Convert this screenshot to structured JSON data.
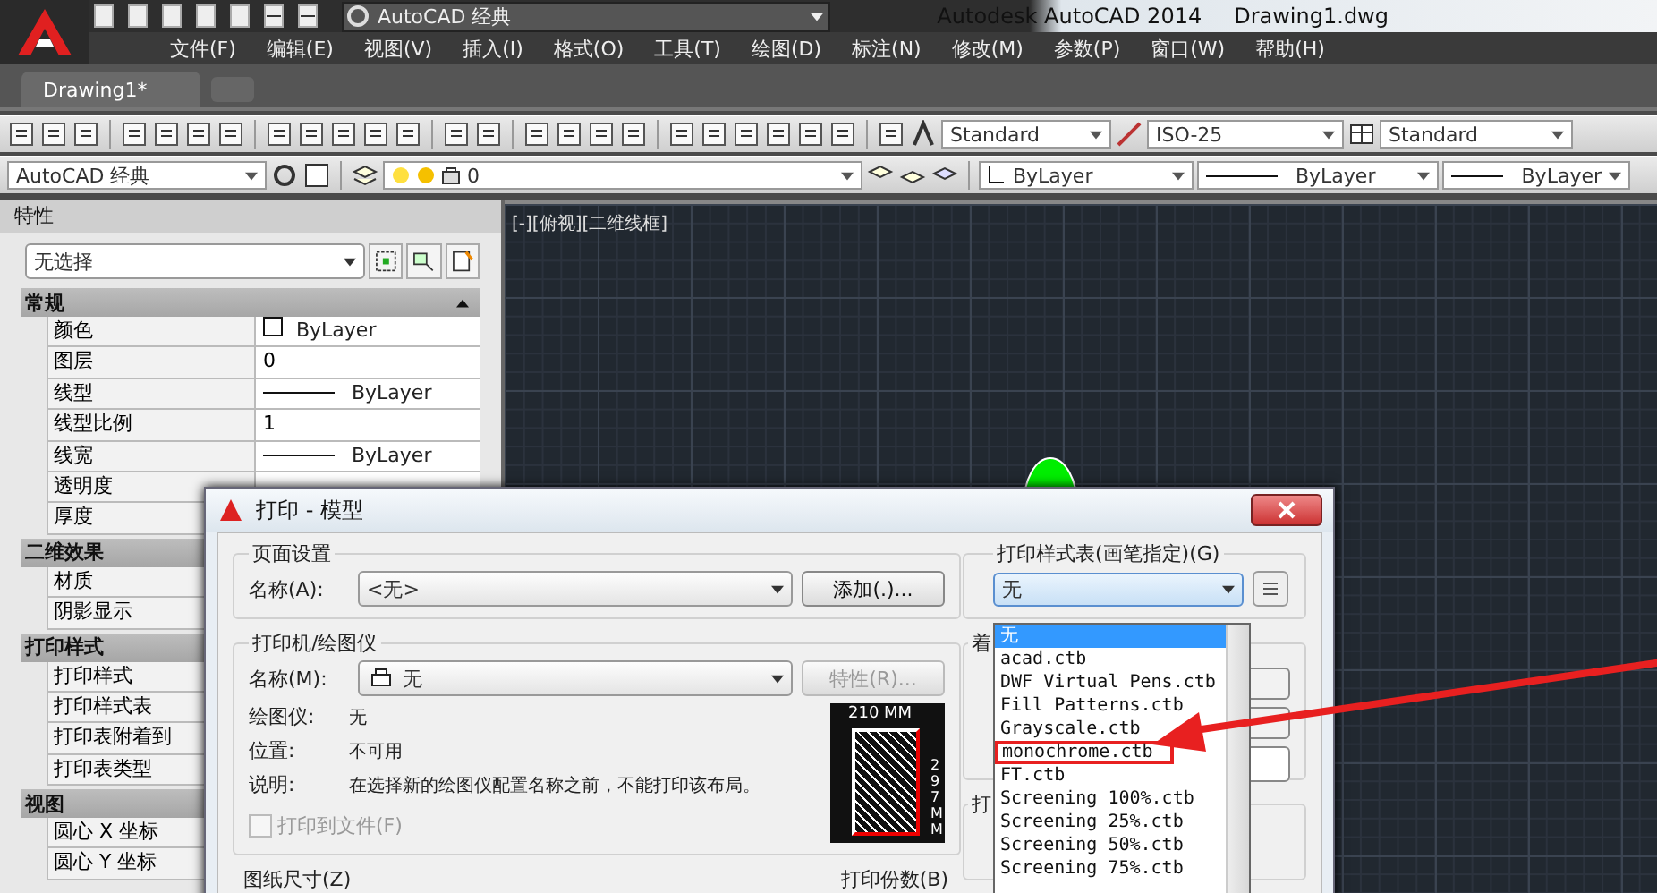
{
  "title_bar": {
    "workspace": "AutoCAD 经典",
    "app_title": "Autodesk AutoCAD 2014",
    "file_name": "Drawing1.dwg"
  },
  "menu": [
    "文件(F)",
    "编辑(E)",
    "视图(V)",
    "插入(I)",
    "格式(O)",
    "工具(T)",
    "绘图(D)",
    "标注(N)",
    "修改(M)",
    "参数(P)",
    "窗口(W)",
    "帮助(H)"
  ],
  "tabs": [
    {
      "label": "Drawing1*",
      "selected": true
    }
  ],
  "styles_toolbar": {
    "text_style": "Standard",
    "dim_style": "ISO-25",
    "table_style": "Standard"
  },
  "layers_toolbar": {
    "workspace": "AutoCAD 经典",
    "layer": "0",
    "color_setting": "ByLayer",
    "linetype": "ByLayer",
    "lineweight": "ByLayer"
  },
  "properties": {
    "title": "特性",
    "selection": "无选择",
    "sections": [
      {
        "title": "常规",
        "rows": [
          {
            "label": "颜色",
            "value": "ByLayer",
            "kind": "color"
          },
          {
            "label": "图层",
            "value": "0",
            "kind": "text"
          },
          {
            "label": "线型",
            "value": "ByLayer",
            "kind": "line"
          },
          {
            "label": "线型比例",
            "value": "1",
            "kind": "text"
          },
          {
            "label": "线宽",
            "value": "ByLayer",
            "kind": "line"
          },
          {
            "label": "透明度",
            "kind": "text"
          },
          {
            "label": "厚度",
            "kind": "text"
          }
        ]
      },
      {
        "title": "二维效果",
        "rows": [
          {
            "label": "材质",
            "kind": "text"
          },
          {
            "label": "阴影显示",
            "kind": "text"
          }
        ]
      },
      {
        "title": "打印样式",
        "rows": [
          {
            "label": "打印样式",
            "kind": "text"
          },
          {
            "label": "打印样式表",
            "kind": "text"
          },
          {
            "label": "打印表附着到",
            "kind": "text"
          },
          {
            "label": "打印表类型",
            "kind": "text"
          }
        ]
      },
      {
        "title": "视图",
        "rows": [
          {
            "label": "圆心 X 坐标",
            "kind": "text"
          },
          {
            "label": "圆心 Y 坐标",
            "kind": "text"
          }
        ]
      }
    ]
  },
  "viewport": {
    "label": "[-][俯视][二维线框]"
  },
  "plot_dialog": {
    "title": "打印 - 模型",
    "page_setup": {
      "legend": "页面设置",
      "name_label": "名称(A):",
      "name_value": "<无>",
      "add_button": "添加(.)..."
    },
    "printer": {
      "legend": "打印机/绘图仪",
      "name_label": "名称(M):",
      "name_value": "无",
      "properties_button": "特性(R)...",
      "info": [
        {
          "label": "绘图仪:",
          "value": "无"
        },
        {
          "label": "位置:",
          "value": "不可用"
        },
        {
          "label": "说明:",
          "value": "在选择新的绘图仪配置名称之前，不能打印该布局。"
        }
      ],
      "print_to_file": {
        "label": "打印到文件(F)",
        "checked": false
      },
      "paper_width": "210 MM",
      "paper_height": "297 MM"
    },
    "paper_size_legend": "图纸尺寸(Z)",
    "copies_legend": "打印份数(B)",
    "style_table": {
      "legend": "打印样式表(画笔指定)(G)",
      "value": "无",
      "options": [
        {
          "label": "无",
          "selected": true,
          "highlighted": false
        },
        {
          "label": "acad.ctb",
          "selected": false,
          "highlighted": false
        },
        {
          "label": "DWF Virtual Pens.ctb",
          "selected": false,
          "highlighted": false
        },
        {
          "label": "Fill Patterns.ctb",
          "selected": false,
          "highlighted": false
        },
        {
          "label": "Grayscale.ctb",
          "selected": false,
          "highlighted": false
        },
        {
          "label": "monochrome.ctb",
          "selected": false,
          "highlighted": true
        },
        {
          "label": "FT.ctb",
          "selected": false,
          "highlighted": false
        },
        {
          "label": "Screening 100%.ctb",
          "selected": false,
          "highlighted": false
        },
        {
          "label": "Screening 25%.ctb",
          "selected": false,
          "highlighted": false
        },
        {
          "label": "Screening 50%.ctb",
          "selected": false,
          "highlighted": false
        },
        {
          "label": "Screening 75%.ctb",
          "selected": false,
          "highlighted": false
        }
      ]
    },
    "shading_legend": "着",
    "plot_options_legend": "打"
  }
}
